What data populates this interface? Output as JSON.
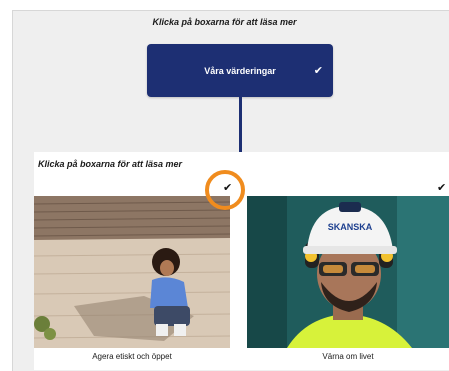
{
  "top": {
    "instruction": "Klicka på boxarna för att läsa mer",
    "values_button_label": "Våra värderingar",
    "values_button_check": "✔"
  },
  "panel": {
    "instruction": "Klicka på boxarna för att läsa mer",
    "cards": [
      {
        "caption": "Agera etiskt och öppet",
        "check": "✔"
      },
      {
        "caption": "Värna om livet",
        "check": "✔"
      }
    ]
  },
  "helmet_text": "SKANSKA",
  "colors": {
    "navy": "#1d2f73",
    "highlight_orange": "#f08c1e",
    "canvas_gray": "#efefef"
  }
}
